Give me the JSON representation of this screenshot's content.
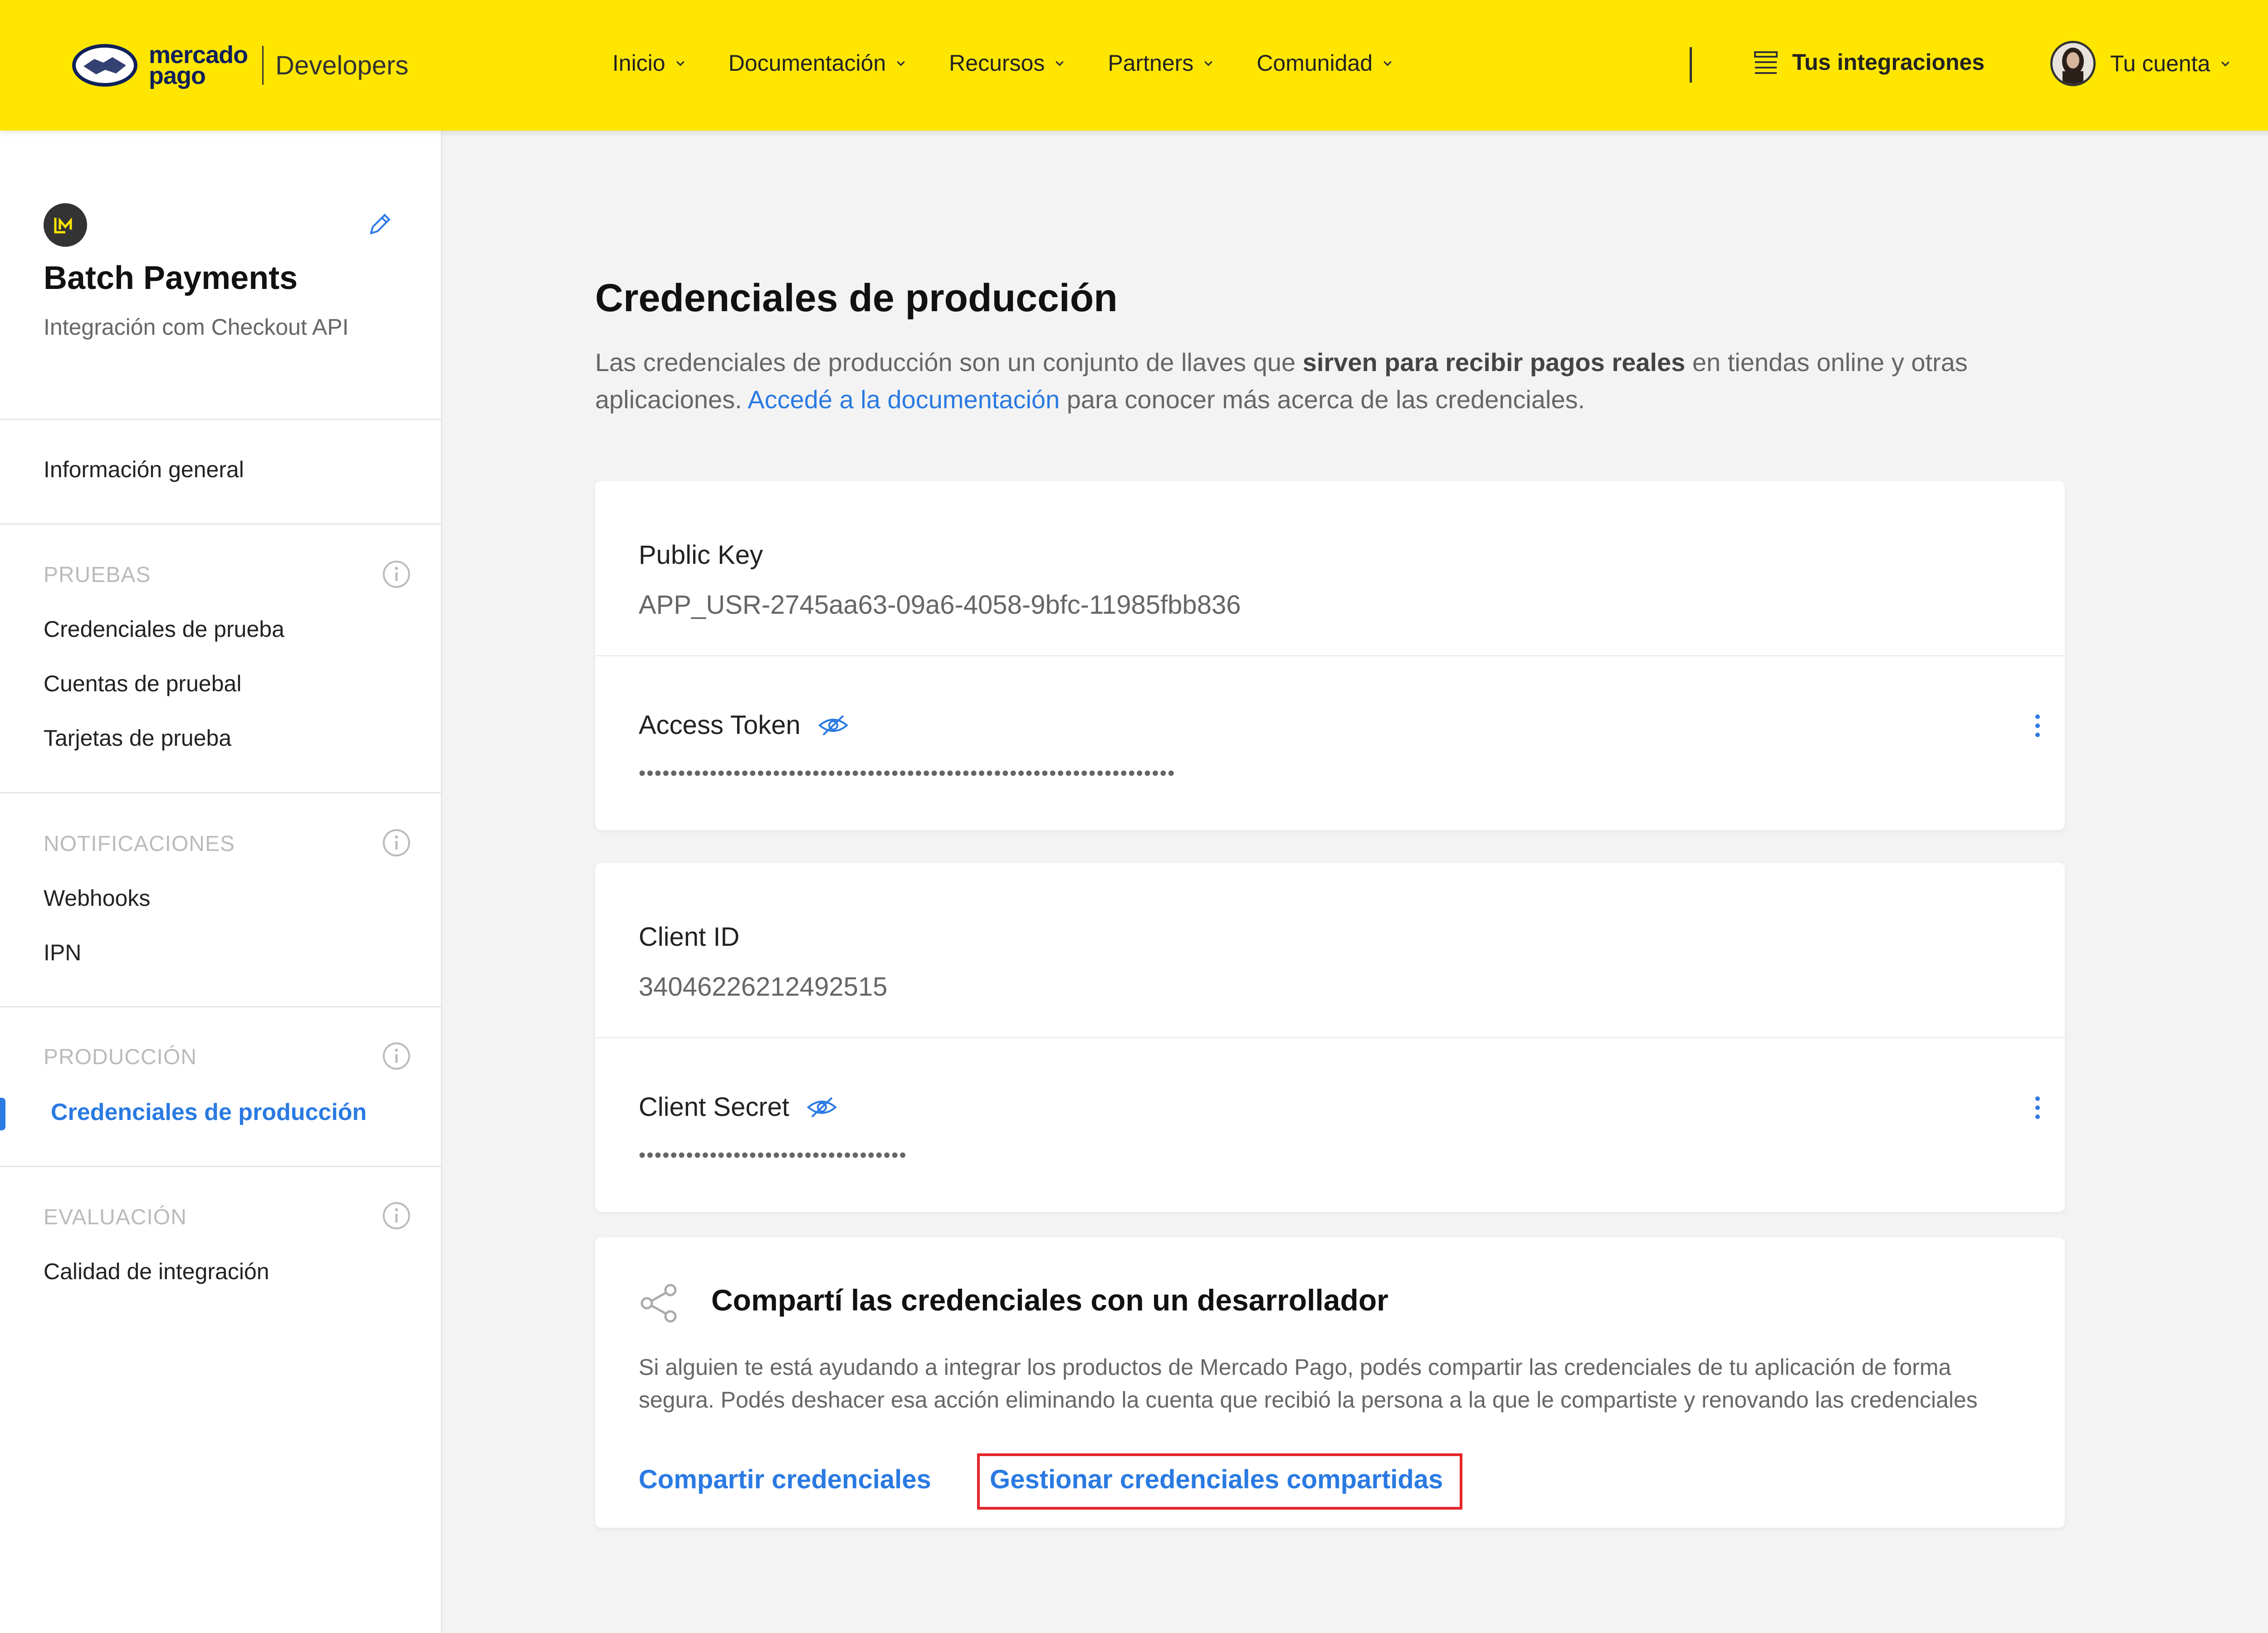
{
  "header": {
    "brand_line1": "mercado",
    "brand_line2": "pago",
    "developers": "Developers",
    "nav": [
      {
        "label": "Inicio"
      },
      {
        "label": "Documentación"
      },
      {
        "label": "Recursos"
      },
      {
        "label": "Partners"
      },
      {
        "label": "Comunidad"
      }
    ],
    "integrations": "Tus integraciones",
    "account": "Tu cuenta"
  },
  "sidebar": {
    "app_title": "Batch Payments",
    "app_subtitle": "Integración com Checkout API",
    "general": "Información general",
    "sections": [
      {
        "heading": "PRUEBAS",
        "items": [
          "Credenciales de prueba",
          "Cuentas de pruebal",
          "Tarjetas de prueba"
        ]
      },
      {
        "heading": "NOTIFICACIONES",
        "items": [
          "Webhooks",
          "IPN"
        ]
      },
      {
        "heading": "PRODUCCIÓN",
        "items": [
          "Credenciales de producción"
        ]
      },
      {
        "heading": "EVALUACIÓN",
        "items": [
          "Calidad de integración"
        ]
      }
    ]
  },
  "main": {
    "title": "Credenciales de producción",
    "desc_part1": "Las credenciales de producción son un conjunto de llaves que ",
    "desc_bold": "sirven para recibir pagos reales",
    "desc_part2": " en tiendas online y otras aplicaciones. ",
    "desc_link": "Accedé a la documentación",
    "desc_part3": " para conocer más acerca de las credenciales.",
    "public_key_label": "Public Key",
    "public_key_value": "APP_USR-2745aa63-09a6-4058-9bfc-11985fbb836",
    "access_token_label": "Access Token",
    "access_token_value": "••••••••••••••••••••••••••••••••••••••••••••••••••••••••••••••••••••",
    "client_id_label": "Client ID",
    "client_id_value": "34046226212492515",
    "client_secret_label": "Client Secret",
    "client_secret_value": "••••••••••••••••••••••••••••••••••",
    "share_title": "Compartí las credenciales con un desarrollador",
    "share_desc": "Si alguien te está ayudando a integrar los productos de Mercado Pago, podés compartir las credenciales de tu aplicación de forma segura. Podés deshacer esa acción eliminando la cuenta que recibió la persona a la que le compartiste y renovando las credenciales",
    "share_action": "Compartir credenciales",
    "manage_action": "Gestionar credenciales compartidas"
  },
  "colors": {
    "header": "#ffe600",
    "link": "#2a7ae2",
    "highlight": "#e3262b"
  }
}
